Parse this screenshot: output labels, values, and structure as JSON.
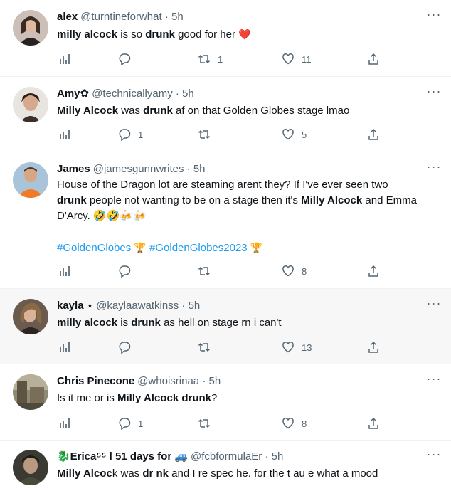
{
  "tweets": [
    {
      "name": "alex",
      "handle": "@turntineforwhat",
      "time": "5h",
      "text": [
        {
          "t": "milly alcock",
          "b": true
        },
        {
          "t": " is so "
        },
        {
          "t": "drunk",
          "b": true
        },
        {
          "t": " good for her "
        }
      ],
      "emoji": "❤️",
      "replies": "",
      "retweets": "1",
      "likes": "11"
    },
    {
      "name": "Amy✿",
      "handle": "@technicallyamy",
      "time": "5h",
      "text": [
        {
          "t": "Milly Alcock",
          "b": true
        },
        {
          "t": " was "
        },
        {
          "t": "drunk",
          "b": true
        },
        {
          "t": " af on that Golden Globes stage lmao"
        }
      ],
      "replies": "1",
      "retweets": "",
      "likes": "5"
    },
    {
      "name": "James",
      "handle": "@jamesgunnwrites",
      "time": "5h",
      "line1": "House of the Dragon lot are steaming arent they? If I've ever seen two",
      "line2": [
        {
          "t": "drunk",
          "b": true
        },
        {
          "t": " people not wanting to be on a stage then it's "
        },
        {
          "t": "Milly Alcock",
          "b": true
        },
        {
          "t": " and Emma"
        }
      ],
      "line3": "D'Arcy. 🤣🤣🍻🍻",
      "tag1": "#GoldenGlobes",
      "tag2": "#GoldenGlobes2023",
      "trophy": "🏆",
      "replies": "",
      "retweets": "",
      "likes": "8"
    },
    {
      "name": "kayla",
      "handle_prefix": "⋆",
      "handle": "@kaylaawatkinss",
      "time": "5h",
      "text": [
        {
          "t": "milly alcock",
          "b": true
        },
        {
          "t": " is "
        },
        {
          "t": "drunk",
          "b": true
        },
        {
          "t": " as hell on stage rn i can't"
        }
      ],
      "replies": "",
      "retweets": "",
      "likes": "13"
    },
    {
      "name": "Chris Pinecone",
      "handle": "@whoisrinaa",
      "time": "5h",
      "text": [
        {
          "t": "Is it me or is "
        },
        {
          "t": "Milly Alcock drunk",
          "b": true
        },
        {
          "t": "?"
        }
      ],
      "replies": "1",
      "retweets": "",
      "likes": "8"
    },
    {
      "name": "🐉Erica⁵⁵ l 51 days for 🚙",
      "handle": "@fcbformulaEr",
      "time": "5h",
      "text": [
        {
          "t": "Milly Alcoc",
          "b": true
        },
        {
          "t": "k was "
        },
        {
          "t": "dr nk",
          "b": true
        },
        {
          "t": " and I re spec he. for the t au e what a mood"
        }
      ]
    }
  ],
  "icons": {
    "stats": "stats-icon",
    "reply": "reply-icon",
    "retweet": "retweet-icon",
    "like": "heart-icon",
    "share": "share-icon",
    "more": "more-icon"
  },
  "colors": {
    "text": "#0f1419",
    "muted": "#536471",
    "link": "#1d9bf0",
    "highlight_bg": "#f7f7f7",
    "divider": "#eff3f4"
  }
}
